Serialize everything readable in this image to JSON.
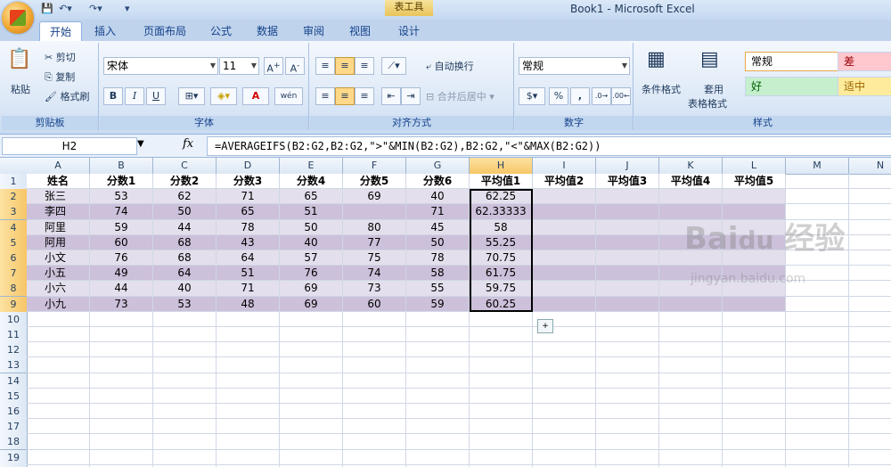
{
  "window": {
    "title": "Book1 - Microsoft Excel",
    "context_tab": "表工具"
  },
  "tabs": [
    "开始",
    "插入",
    "页面布局",
    "公式",
    "数据",
    "审阅",
    "视图",
    "设计"
  ],
  "active_tab": "开始",
  "ribbon": {
    "clipboard": {
      "label": "剪贴板",
      "paste": "粘贴",
      "cut": "剪切",
      "copy": "复制",
      "format_painter": "格式刷"
    },
    "font": {
      "label": "字体",
      "font_name": "宋体",
      "font_size": "11",
      "bold": "B",
      "italic": "I",
      "underline": "U",
      "font_color": "A",
      "wen": "wén"
    },
    "alignment": {
      "label": "对齐方式",
      "wrap": "自动换行",
      "merge": "合并后居中"
    },
    "number": {
      "label": "数字",
      "format": "常规",
      "percent": "%",
      "comma": ","
    },
    "styles": {
      "label": "样式",
      "conditional": "条件格式",
      "table_format": "套用\n表格格式",
      "table_format_line1": "套用",
      "table_format_line2": "表格格式",
      "cells": [
        {
          "name": "常规",
          "bg": "#ffffff",
          "fg": "#000000"
        },
        {
          "name": "差",
          "bg": "#ffc7ce",
          "fg": "#9c0006"
        },
        {
          "name": "好",
          "bg": "#c6efce",
          "fg": "#006100"
        },
        {
          "name": "适中",
          "bg": "#ffeb9c",
          "fg": "#9c6500"
        }
      ]
    }
  },
  "formula_bar": {
    "name_box": "H2",
    "fx": "fx",
    "formula": "=AVERAGEIFS(B2:G2,B2:G2,\">\"&MIN(B2:G2),B2:G2,\"<\"&MAX(B2:G2))"
  },
  "columns": [
    "A",
    "B",
    "C",
    "D",
    "E",
    "F",
    "G",
    "H",
    "I",
    "J",
    "K",
    "L",
    "M",
    "N"
  ],
  "selected_column": "H",
  "rows_visible": 20,
  "sheet": [
    [
      "姓名",
      "分数1",
      "分数2",
      "分数3",
      "分数4",
      "分数5",
      "分数6",
      "平均值1",
      "平均值2",
      "平均值3",
      "平均值4",
      "平均值5"
    ],
    [
      "张三",
      "53",
      "62",
      "71",
      "65",
      "69",
      "40",
      "62.25",
      "",
      "",
      "",
      ""
    ],
    [
      "李四",
      "74",
      "50",
      "65",
      "51",
      "",
      "71",
      "62.33333",
      "",
      "",
      "",
      ""
    ],
    [
      "阿里",
      "59",
      "44",
      "78",
      "50",
      "80",
      "45",
      "58",
      "",
      "",
      "",
      ""
    ],
    [
      "阿用",
      "60",
      "68",
      "43",
      "40",
      "77",
      "50",
      "55.25",
      "",
      "",
      "",
      ""
    ],
    [
      "小文",
      "76",
      "68",
      "64",
      "57",
      "75",
      "78",
      "70.75",
      "",
      "",
      "",
      ""
    ],
    [
      "小五",
      "49",
      "64",
      "51",
      "76",
      "74",
      "58",
      "61.75",
      "",
      "",
      "",
      ""
    ],
    [
      "小六",
      "44",
      "40",
      "71",
      "69",
      "73",
      "55",
      "59.75",
      "",
      "",
      "",
      ""
    ],
    [
      "小九",
      "73",
      "53",
      "48",
      "69",
      "60",
      "59",
      "60.25",
      "",
      "",
      "",
      ""
    ]
  ],
  "table_colors": {
    "odd": "#e4dfec",
    "even": "#ccc0da",
    "header": "#ffffff"
  },
  "watermark": {
    "text": "Bai 经验",
    "url": "jingyan.baidu.com"
  }
}
